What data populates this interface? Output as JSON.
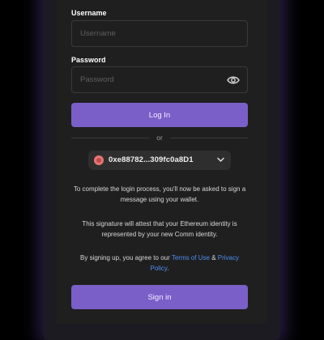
{
  "form": {
    "username_label": "Username",
    "username_placeholder": "Username",
    "password_label": "Password",
    "password_placeholder": "Password",
    "login_label": "Log In",
    "or_label": "or",
    "signin_label": "Sign in"
  },
  "wallet": {
    "address": "0xe88782...309fc0a8D1",
    "avatar_color": "#e87575"
  },
  "info": {
    "login_process": "To complete the login process, you'll now be asked to sign a message using your wallet.",
    "signature_note": "This signature will attest that your Ethereum identity is represented by your new Comm identity.",
    "agree_prefix": "By signing up, you agree to our ",
    "terms_link": "Terms of Use",
    "agree_and": " & ",
    "privacy_link": "Privacy Policy",
    "agree_suffix": "."
  },
  "colors": {
    "accent": "#7b5fc8",
    "link": "#4d8ef0",
    "background": "#1f1f1f"
  },
  "icons": {
    "password_toggle": "eye-icon",
    "wallet_dropdown": "chevron-down-icon"
  }
}
